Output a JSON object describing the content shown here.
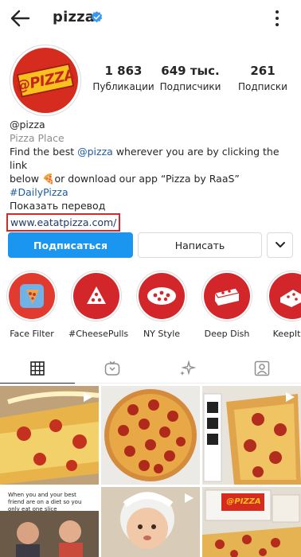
{
  "header": {
    "username": "pizza"
  },
  "profile": {
    "avatar_logo_text": "@PIZZA",
    "stats": [
      {
        "value": "1 863",
        "label": "Публикации"
      },
      {
        "value": "649 тыс.",
        "label": "Подписчики"
      },
      {
        "value": "261",
        "label": "Подписки"
      }
    ],
    "bio": {
      "handle": "@pizza",
      "category": "Pizza Place",
      "line1_prefix": "Find the best ",
      "line1_mention": "@pizza",
      "line1_suffix": " wherever you are by clicking the link",
      "line2": "below 🍕or download our app “Pizza by RaaS”",
      "hashtag": "#DailyPizza",
      "translate": "Показать перевод",
      "link": "www.eatatpizza.com/"
    }
  },
  "actions": {
    "follow": "Подписаться",
    "message": "Написать"
  },
  "highlights": [
    {
      "label": "Face Filter"
    },
    {
      "label": "#CheesePulls"
    },
    {
      "label": "NY Style"
    },
    {
      "label": "Deep Dish"
    },
    {
      "label": "KeepItSq"
    }
  ],
  "grid": {
    "meme_text": "When you and your best friend are on a diet so you only eat one slice",
    "box_text": "@PIZZA"
  },
  "colors": {
    "accent": "#1a96f0",
    "brand_red": "#d3262a",
    "link_highlight": "#d62828"
  }
}
